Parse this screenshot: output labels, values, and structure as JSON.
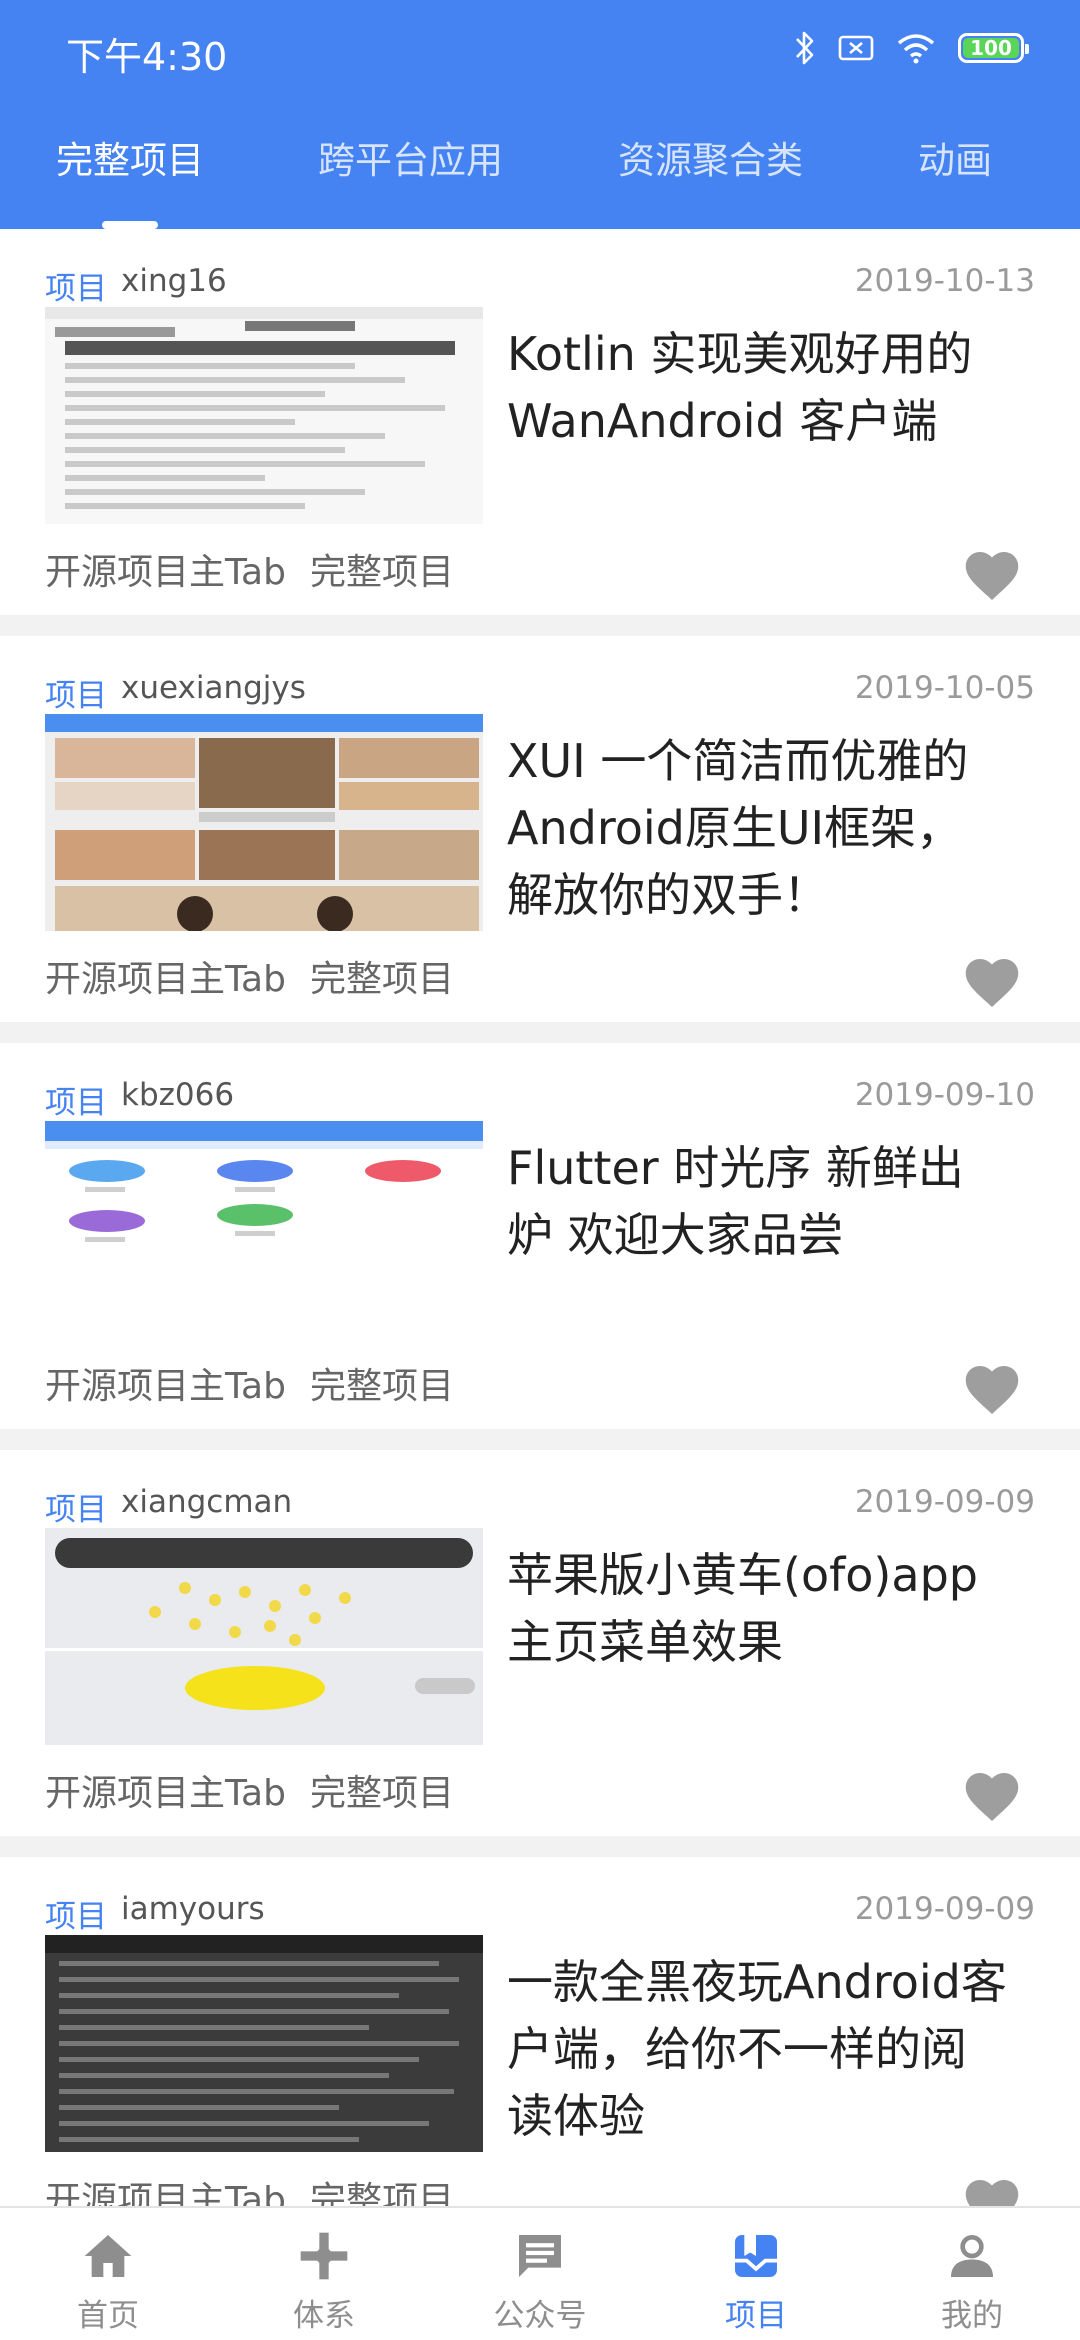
{
  "status_bar": {
    "time": "下午4:30",
    "battery": "100"
  },
  "tabs": [
    {
      "label": "完整项目",
      "active": true
    },
    {
      "label": "跨平台应用",
      "active": false
    },
    {
      "label": "资源聚合类",
      "active": false
    },
    {
      "label": "动画",
      "active": false
    }
  ],
  "articles": [
    {
      "tag": "项目",
      "author": "xing16",
      "date": "2019-10-13",
      "title": "Kotlin 实现美观好用的 WanAndroid 客户端",
      "chapter_super": "开源项目主Tab",
      "chapter": "完整项目"
    },
    {
      "tag": "项目",
      "author": "xuexiangjys",
      "date": "2019-10-05",
      "title": "XUI 一个简洁而优雅的Android原生UI框架，解放你的双手！",
      "chapter_super": "开源项目主Tab",
      "chapter": "完整项目"
    },
    {
      "tag": "项目",
      "author": "kbz066",
      "date": "2019-09-10",
      "title": "Flutter 时光序 新鲜出炉 欢迎大家品尝",
      "chapter_super": "开源项目主Tab",
      "chapter": "完整项目"
    },
    {
      "tag": "项目",
      "author": "xiangcman",
      "date": "2019-09-09",
      "title": "苹果版小黄车(ofo)app主页菜单效果",
      "chapter_super": "开源项目主Tab",
      "chapter": "完整项目"
    },
    {
      "tag": "项目",
      "author": "iamyours",
      "date": "2019-09-09",
      "title": "一款全黑夜玩Android客户端，给你不一样的阅读体验",
      "chapter_super": "开源项目主Tab",
      "chapter": "完整项目"
    }
  ],
  "bottom_nav": [
    {
      "label": "首页",
      "icon": "home-icon",
      "active": false
    },
    {
      "label": "体系",
      "icon": "system-icon",
      "active": false
    },
    {
      "label": "公众号",
      "icon": "message-icon",
      "active": false
    },
    {
      "label": "项目",
      "icon": "project-icon",
      "active": true
    },
    {
      "label": "我的",
      "icon": "user-icon",
      "active": false
    }
  ],
  "colors": {
    "primary": "#4683f2",
    "heart": "#9e9e9e",
    "divider": "#f2f2f2"
  }
}
